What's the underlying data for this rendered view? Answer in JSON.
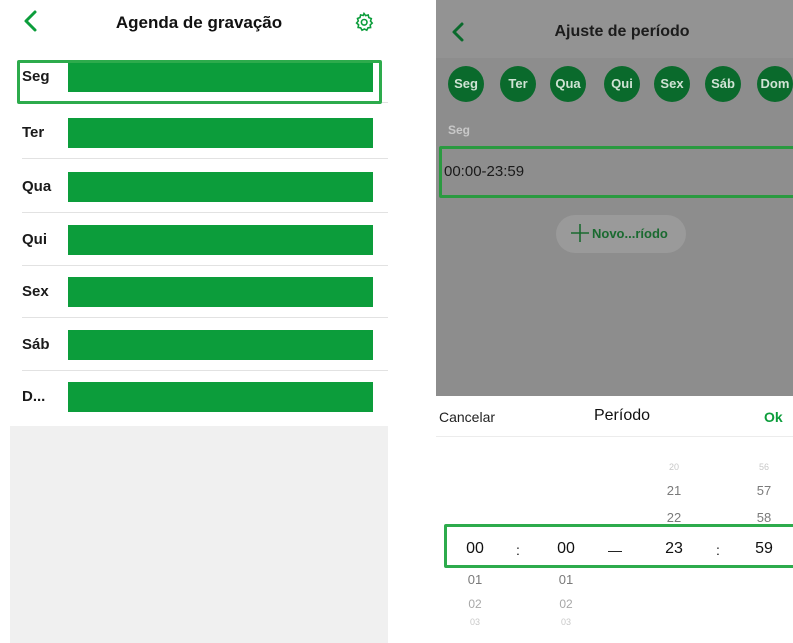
{
  "schedule": {
    "title": "Agenda de gravação",
    "days": [
      {
        "label": "Seg"
      },
      {
        "label": "Ter"
      },
      {
        "label": "Qua"
      },
      {
        "label": "Qui"
      },
      {
        "label": "Sex"
      },
      {
        "label": "Sáb"
      },
      {
        "label": "D..."
      }
    ]
  },
  "period_settings": {
    "title": "Ajuste de período",
    "weekday_chips": [
      "Seg",
      "Ter",
      "Qua",
      "Qui",
      "Sex",
      "Sáb",
      "Dom"
    ],
    "selected_day_label": "Seg",
    "periods": [
      "00:00-23:59"
    ],
    "new_period_label": "Novo...ríodo"
  },
  "picker": {
    "cancel_label": "Cancelar",
    "title": "Período",
    "ok_label": "Ok",
    "separator": ":",
    "dash": "—",
    "start_hour": {
      "above": [],
      "selected": "00",
      "below": [
        "01",
        "02",
        "03"
      ]
    },
    "start_minute": {
      "above": [],
      "selected": "00",
      "below": [
        "01",
        "02",
        "03"
      ]
    },
    "end_hour": {
      "above": [
        "20",
        "21",
        "22"
      ],
      "selected": "23",
      "below": []
    },
    "end_minute": {
      "above": [
        "56",
        "57",
        "58"
      ],
      "selected": "59",
      "below": []
    }
  },
  "colors": {
    "accent": "#0c9d3b",
    "highlight_border": "#2dab4c",
    "chip": "#0a6a2c"
  }
}
